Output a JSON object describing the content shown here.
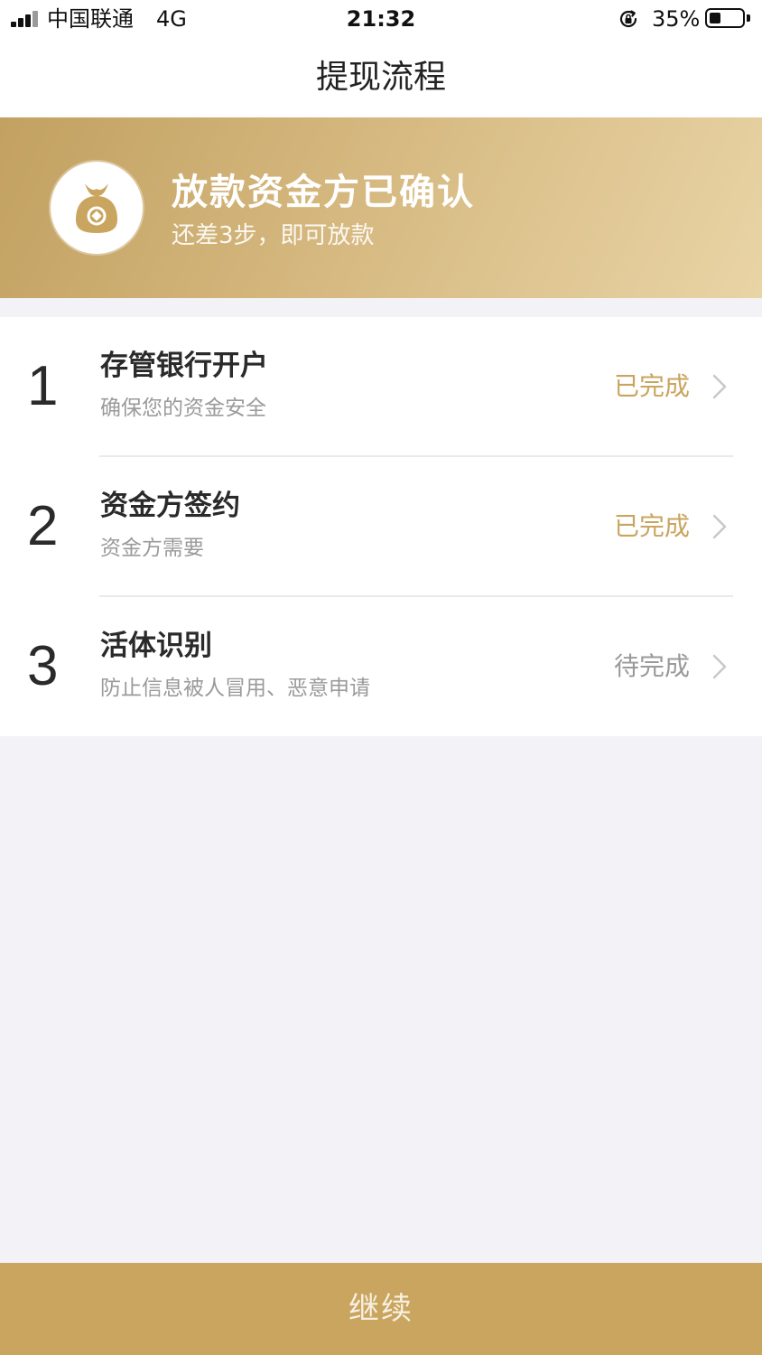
{
  "status_bar": {
    "carrier": "中国联通",
    "network": "4G",
    "time": "21:32",
    "battery_percent": "35%",
    "battery_level": 0.35
  },
  "nav": {
    "title": "提现流程"
  },
  "banner": {
    "icon": "money-bag-icon",
    "title": "放款资金方已确认",
    "subtitle": "还差3步，即可放款"
  },
  "steps": [
    {
      "number": "1",
      "title": "存管银行开户",
      "description": "确保您的资金安全",
      "status": "已完成",
      "status_color": "#c9a55f"
    },
    {
      "number": "2",
      "title": "资金方签约",
      "description": "资金方需要",
      "status": "已完成",
      "status_color": "#c9a55f"
    },
    {
      "number": "3",
      "title": "活体识别",
      "description": "防止信息被人冒用、恶意申请",
      "status": "待完成",
      "status_color": "#9a9a9a"
    }
  ],
  "footer": {
    "continue_label": "继续"
  },
  "colors": {
    "accent": "#c9a55f",
    "background": "#f3f3f7"
  }
}
